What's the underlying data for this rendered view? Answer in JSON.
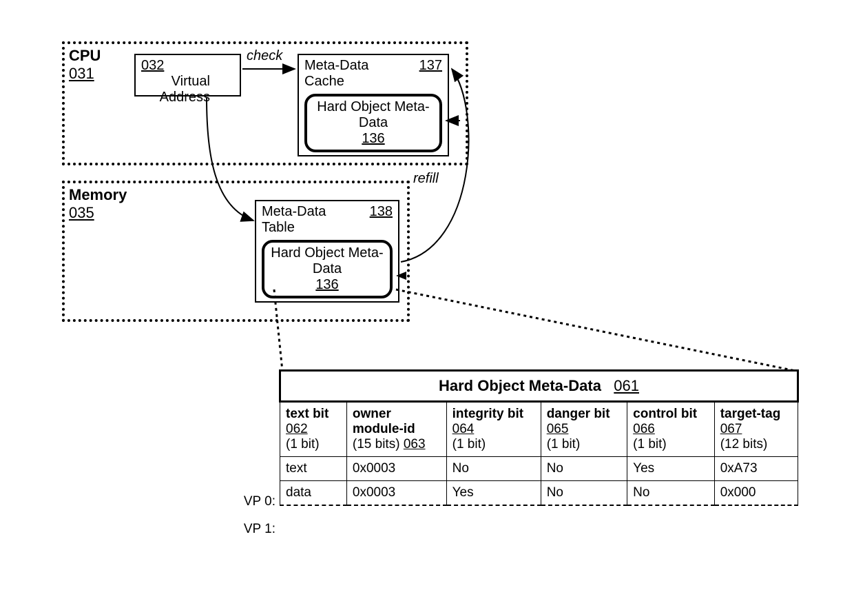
{
  "cpu": {
    "label": "CPU",
    "ref": "031",
    "virtual_address": {
      "ref": "032",
      "label": "Virtual Address"
    },
    "meta_data_cache": {
      "label": "Meta-Data Cache",
      "ref": "137",
      "inner": {
        "label": "Hard Object Meta-Data",
        "ref": "136"
      }
    },
    "edge_check": "check"
  },
  "memory": {
    "label": "Memory",
    "ref": "035",
    "meta_data_table": {
      "label": "Meta-Data Table",
      "ref": "138",
      "inner": {
        "label": "Hard Object Meta-Data",
        "ref": "136"
      }
    },
    "edge_refill": "refill"
  },
  "table": {
    "title": "Hard Object Meta-Data",
    "title_ref": "061",
    "columns": [
      {
        "name": "text bit",
        "ref": "062",
        "bits": "(1 bit)"
      },
      {
        "name": "owner module-id",
        "ref": "063",
        "bits": "(15 bits)"
      },
      {
        "name": "integrity bit",
        "ref": "064",
        "bits": "(1 bit)"
      },
      {
        "name": "danger bit",
        "ref": "065",
        "bits": "(1 bit)"
      },
      {
        "name": "control bit",
        "ref": "066",
        "bits": "(1 bit)"
      },
      {
        "name": "target-tag",
        "ref": "067",
        "bits": "(12 bits)"
      }
    ],
    "rows": [
      {
        "label": "VP 0:",
        "cells": [
          "text",
          "0x0003",
          "No",
          "No",
          "Yes",
          "0xA73"
        ]
      },
      {
        "label": "VP 1:",
        "cells": [
          "data",
          "0x0003",
          "Yes",
          "No",
          "No",
          "0x000"
        ]
      }
    ]
  }
}
